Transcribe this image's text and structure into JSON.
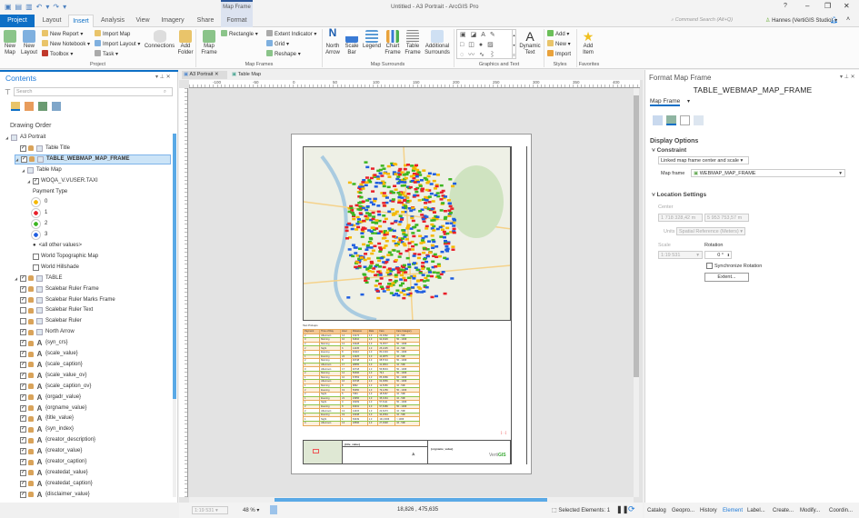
{
  "window": {
    "title": "Untitled - A3 Portrait - ArcGIS Pro",
    "context_tab_group": "Map Frame",
    "help": "?",
    "search_placeholder": "Command Search (Alt+Q)",
    "user": "Hannes (VertiGIS Studio)"
  },
  "tabs": [
    "Project",
    "Layout",
    "Insert",
    "Analysis",
    "View",
    "Imagery",
    "Share",
    "Format"
  ],
  "ribbon": {
    "project": {
      "label": "Project",
      "new_map": "New Map",
      "new_layout": "New Layout",
      "new_report": "New Report",
      "new_notebook": "New Notebook",
      "toolbox": "Toolbox",
      "import_map": "Import Map",
      "import_layout": "Import Layout",
      "task": "Task",
      "connections": "Connections",
      "add_folder": "Add Folder"
    },
    "map_frames": {
      "label": "Map Frames",
      "map_frame": "Map Frame",
      "rectangle": "Rectangle",
      "extent_indicator": "Extent Indicator",
      "grid": "Grid",
      "reshape": "Reshape"
    },
    "map_surrounds": {
      "label": "Map Surrounds",
      "north_arrow": "North Arrow",
      "scale_bar": "Scale Bar",
      "legend": "Legend",
      "chart_frame": "Chart Frame",
      "table_frame": "Table Frame",
      "additional": "Additional Surrounds"
    },
    "graphics": {
      "label": "Graphics and Text",
      "dynamic_text": "Dynamic Text"
    },
    "styles": {
      "label": "Styles",
      "add": "Add",
      "new": "New",
      "import": "Import"
    },
    "favorites": {
      "label": "Favorites",
      "add_item": "Add Item"
    }
  },
  "contents": {
    "title": "Contents",
    "search_placeholder": "Search",
    "drawing_order": "Drawing Order",
    "items": [
      {
        "label": "A3 Portrait",
        "level": 0
      },
      {
        "label": "Table Title",
        "level": 1,
        "checked": true
      },
      {
        "label": "TABLE_WEBMAP_MAP_FRAME",
        "level": 1,
        "checked": true,
        "selected": true
      },
      {
        "label": "Table Map",
        "level": 2
      },
      {
        "label": "WOQA_V.VUSER.TAXI",
        "level": 3,
        "checked": true
      },
      {
        "label": "Payment Type",
        "level": 4
      },
      {
        "label": "0",
        "level": 5,
        "color": "#f5b800"
      },
      {
        "label": "1",
        "level": 5,
        "color": "#e8202a"
      },
      {
        "label": "2",
        "level": 5,
        "color": "#3cb521"
      },
      {
        "label": "3",
        "level": 5,
        "color": "#1f5ee0"
      },
      {
        "label": "<all other values>",
        "level": 4
      },
      {
        "label": "World Topographic Map",
        "level": 3,
        "checked": false
      },
      {
        "label": "World Hillshade",
        "level": 3,
        "checked": false
      },
      {
        "label": "TABLE",
        "level": 1,
        "checked": true
      },
      {
        "label": "Scalebar Ruler Frame",
        "level": 1,
        "checked": true
      },
      {
        "label": "Scalebar Ruler Marks Frame",
        "level": 1,
        "checked": true
      },
      {
        "label": "Scalebar Ruler Text",
        "level": 1,
        "checked": false
      },
      {
        "label": "Scalebar Ruler",
        "level": 1,
        "checked": false
      },
      {
        "label": "North Arrow",
        "level": 1,
        "checked": true
      },
      {
        "label": "{syn_crs}",
        "level": 1,
        "checked": true
      },
      {
        "label": "{scale_value}",
        "level": 1,
        "checked": true
      },
      {
        "label": "{scale_caption}",
        "level": 1,
        "checked": true
      },
      {
        "label": "{scale_value_ov}",
        "level": 1,
        "checked": true
      },
      {
        "label": "{scale_caption_ov}",
        "level": 1,
        "checked": true
      },
      {
        "label": "{orgadr_value}",
        "level": 1,
        "checked": true
      },
      {
        "label": "{orgname_value}",
        "level": 1,
        "checked": true
      },
      {
        "label": "{title_value}",
        "level": 1,
        "checked": true
      },
      {
        "label": "{syn_index}",
        "level": 1,
        "checked": true
      },
      {
        "label": "{creator_description}",
        "level": 1,
        "checked": true
      },
      {
        "label": "{creator_value}",
        "level": 1,
        "checked": true
      },
      {
        "label": "{creator_caption}",
        "level": 1,
        "checked": true
      },
      {
        "label": "{createdat_value}",
        "level": 1,
        "checked": true
      },
      {
        "label": "{createdat_caption}",
        "level": 1,
        "checked": true
      },
      {
        "label": "{disclaimer_value}",
        "level": 1,
        "checked": true
      }
    ]
  },
  "views": {
    "tabs": [
      "A3 Portrait",
      "Table Map"
    ],
    "ruler_ticks": [
      "-100",
      "-50",
      "0",
      "50",
      "100",
      "150",
      "200",
      "250",
      "300",
      "350",
      "400"
    ]
  },
  "layout": {
    "table_title": "Taxi Pickups",
    "columns": [
      "Payment",
      "Time of Day",
      "Hour",
      "Distance",
      "Rate",
      "Fare",
      "Fare Category"
    ],
    "rows": [
      [
        "2",
        "Afternoon",
        "14",
        "13174",
        "1,3",
        "23,0362",
        "10 - 50€"
      ],
      [
        "0",
        "Morning",
        "10",
        "64610",
        "1,3",
        "92,4929",
        "50 - 100€"
      ],
      [
        "2",
        "Morning",
        "12",
        "33428",
        "1,3",
        "73,3577",
        "50 - 100€"
      ],
      [
        "2",
        "Night",
        "6",
        "14435",
        "1,3",
        "25,2435",
        "10 - 50€"
      ],
      [
        "1",
        "Evening",
        "8",
        "46116",
        "1,3",
        "80,1304",
        "50 - 100€"
      ],
      [
        "1",
        "Evening",
        "22",
        "21625",
        "1,3",
        "44,0875",
        "10 - 50€"
      ],
      [
        "2",
        "Morning",
        "8",
        "49748",
        "1,3",
        "68,5724",
        "50 - 100€"
      ],
      [
        "1",
        "Afternoon",
        "17",
        "28655",
        "1,3",
        "41,0813",
        "10 - 50€"
      ],
      [
        "0",
        "Afternoon",
        "17",
        "40718",
        "1,3",
        "56,8034",
        "50 - 100€"
      ],
      [
        "2",
        "Morning",
        "12",
        "50696",
        "1,3",
        "79,4",
        "50 - 100€"
      ],
      [
        "1",
        "Morning",
        "10",
        "67653",
        "1,3",
        "85,0689",
        "50 - 100€"
      ],
      [
        "1",
        "Afternoon",
        "16",
        "49738",
        "1,3",
        "62,0959",
        "50 - 100€"
      ],
      [
        "1",
        "Morning",
        "8",
        "6892",
        "1,3",
        "12,5356",
        "10 - 50€"
      ],
      [
        "2",
        "Evening",
        "19",
        "50950",
        "1,3",
        "79,1259",
        "50 - 100€"
      ],
      [
        "2",
        "Night",
        "5",
        "7953",
        "1,3",
        "18,5367",
        "10 - 50€"
      ],
      [
        "1",
        "Evening",
        "21",
        "23956",
        "1,3",
        "35,0164",
        "10 - 50€"
      ],
      [
        "1",
        "Night",
        "0",
        "29269",
        "1,3",
        "57,6111",
        "50 - 100€"
      ],
      [
        "2",
        "Evening",
        "8",
        "49331",
        "1,3",
        "97,6389",
        "50 - 100€"
      ],
      [
        "2",
        "Afternoon",
        "13",
        "14415",
        "1,3",
        "22,6473",
        "10 - 50€"
      ],
      [
        "1",
        "Evening",
        "19",
        "23438",
        "1,3",
        "34,2564",
        "10 - 50€"
      ],
      [
        "1",
        "Night",
        "1",
        "63049",
        "1,3",
        "131,0036",
        "> 100€"
      ],
      [
        "0",
        "Afternoon",
        "13",
        "18596",
        "1,3",
        "27,0348",
        "10 - 50€"
      ]
    ],
    "footer": {
      "title": "{title_value}",
      "orgname": "{orgname_value}",
      "brand": "VertiGIS",
      "brand_accent": "#3aaa35"
    }
  },
  "format_panel": {
    "title": "Format Map Frame",
    "element": "TABLE_WEBMAP_MAP_FRAME",
    "tab": "Map Frame",
    "display_options": "Display Options",
    "constraint": "Constraint",
    "constraint_value": "Linked map frame center and scale",
    "map_frame_label": "Map frame",
    "map_frame_value": "WEBMAP_MAP_FRAME",
    "location_settings": "Location Settings",
    "center_label": "Center",
    "center_x": "1 718 328,42 m",
    "center_y": "5 953 753,57 m",
    "units_label": "Units",
    "units_value": "Spatial Reference (Meters)",
    "scale_label": "Scale",
    "scale_value": "1:19 531",
    "rotation_label": "Rotation",
    "rotation_value": "0 °",
    "sync_rotation": "Synchronize Rotation",
    "extent_button": "Extent..."
  },
  "status": {
    "scale": "1:19 531",
    "zoom": "48 %",
    "coords": "18,826 , 475,635",
    "selected": "Selected Elements: 1"
  },
  "bottom_tabs": [
    "Catalog",
    "Geopro...",
    "History",
    "Element",
    "Label...",
    "Create...",
    "Modify...",
    "Coordin..."
  ],
  "colors": {
    "accent": "#0d6fc6",
    "selection": "#cce4f7"
  }
}
